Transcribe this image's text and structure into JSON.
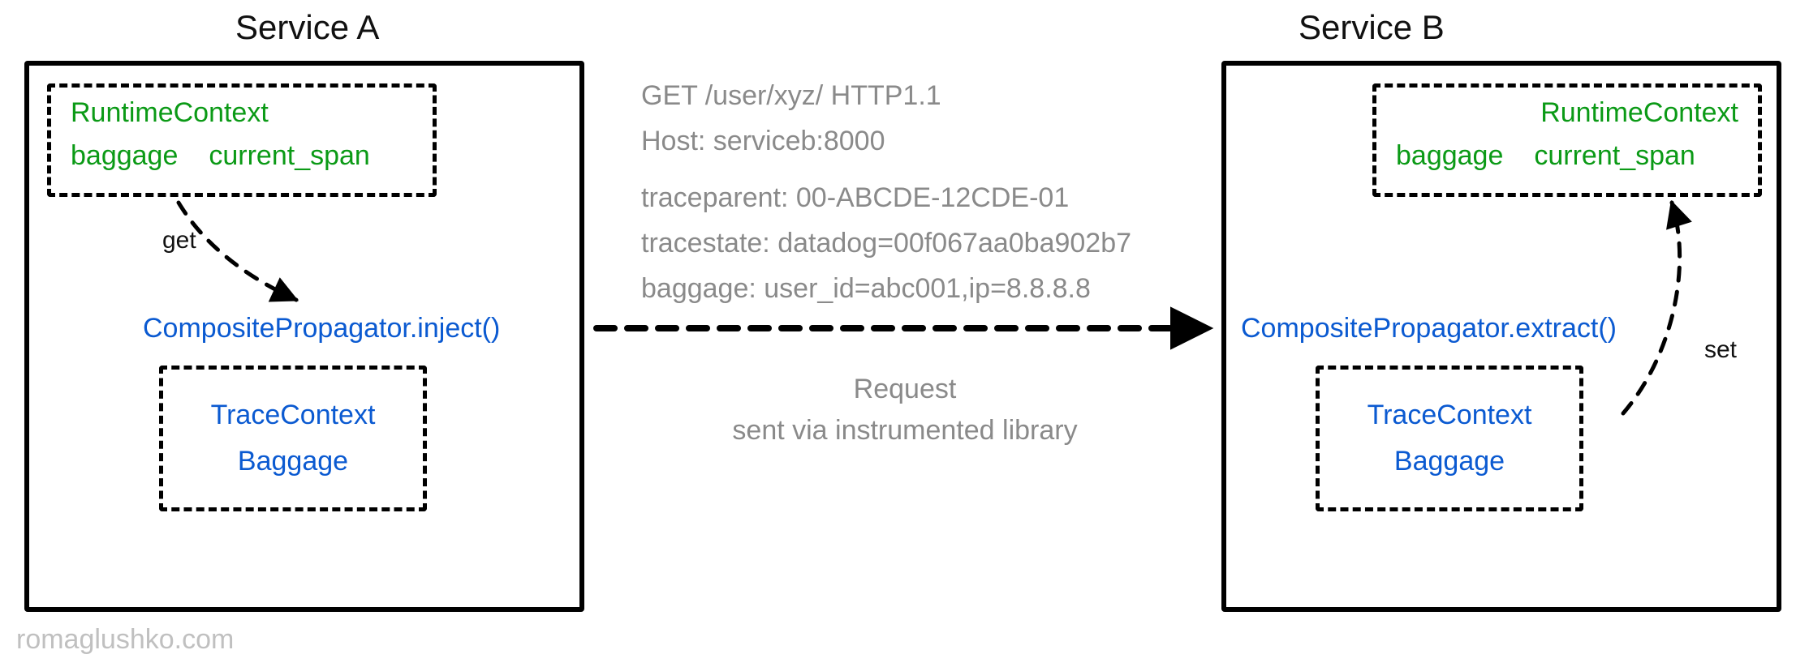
{
  "services": {
    "a": {
      "title": "Service A"
    },
    "b": {
      "title": "Service B"
    }
  },
  "runtime_context": {
    "title": "RuntimeContext",
    "entries": [
      "baggage",
      "current_span"
    ]
  },
  "propagator": {
    "inject_label": "CompositePropagator.inject()",
    "extract_label": "CompositePropagator.extract()",
    "members": [
      "TraceContext",
      "Baggage"
    ]
  },
  "arrows": {
    "get_label": "get",
    "set_label": "set"
  },
  "http": {
    "request_line": "GET /user/xyz/ HTTP1.1",
    "host": "Host: serviceb:8000",
    "traceparent": "traceparent: 00-ABCDE-12CDE-01",
    "tracestate": "tracestate: datadog=00f067aa0ba902b7",
    "baggage": "baggage: user_id=abc001,ip=8.8.8.8"
  },
  "request_caption": {
    "line1": "Request",
    "line2": "sent via instrumented library"
  },
  "watermark": "romaglushko.com"
}
